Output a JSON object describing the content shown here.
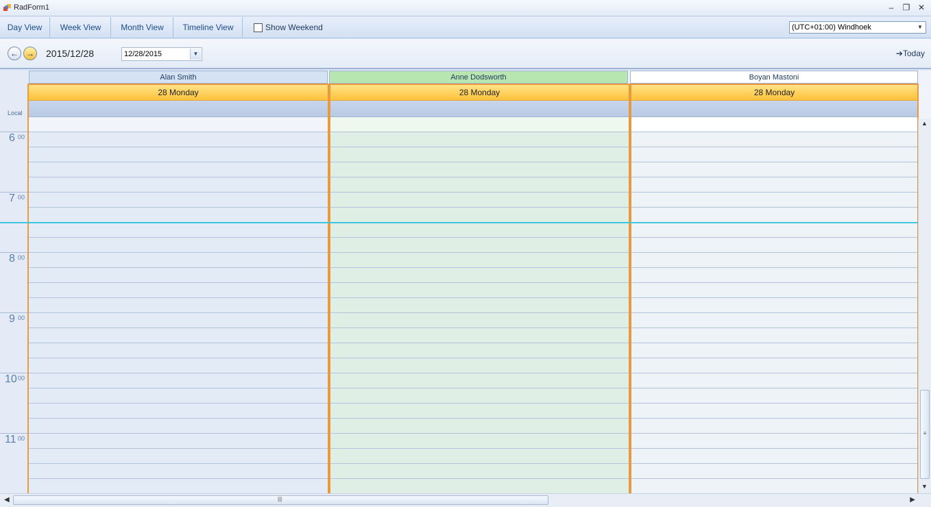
{
  "window": {
    "title": "RadForm1",
    "minimize_glyph": "–",
    "restore_glyph": "❐",
    "close_glyph": "✕"
  },
  "toolbar": {
    "tabs": [
      {
        "label": "Day View"
      },
      {
        "label": "Week View"
      },
      {
        "label": "Month View"
      },
      {
        "label": "Timeline View"
      }
    ],
    "show_weekend_label": "Show Weekend",
    "show_weekend_checked": false,
    "timezone_value": "(UTC+01:00) Windhoek"
  },
  "navigation": {
    "prev_glyph": "←",
    "next_glyph": "→",
    "date_label": "2015/12/28",
    "date_picker_value": "12/28/2015",
    "today_label": "➔Today"
  },
  "scheduler": {
    "timezone_label": "Local",
    "resources": [
      {
        "name": "Alan Smith",
        "header_color": "#d5e2f3",
        "body_color": "#e3ebf6"
      },
      {
        "name": "Anne Dodsworth",
        "header_color": "#b8e6b0",
        "body_color": "#dfefe6"
      },
      {
        "name": "Boyan Mastoni",
        "header_color": "#ffffff",
        "body_color": "#edf3f6"
      }
    ],
    "day_header": "28 Monday",
    "hours": [
      {
        "h": "6",
        "m": "00"
      },
      {
        "h": "7",
        "m": "00"
      },
      {
        "h": "8",
        "m": "00"
      },
      {
        "h": "9",
        "m": "00"
      },
      {
        "h": "10",
        "m": "00"
      },
      {
        "h": "11",
        "m": "00"
      }
    ]
  },
  "colors": {
    "accent_orange": "#e89a3c",
    "current_time_line": "#3fc6dc"
  }
}
